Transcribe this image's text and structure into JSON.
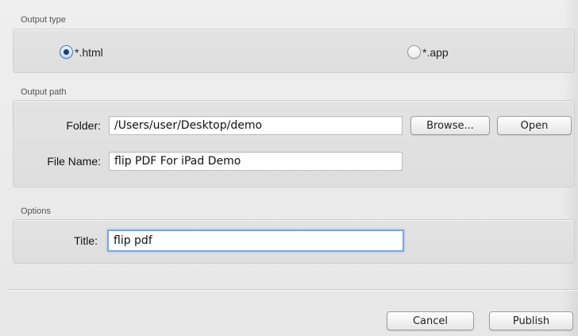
{
  "output_type": {
    "label": "Output type",
    "options": [
      {
        "label": "*.html",
        "selected": true
      },
      {
        "label": "*.app",
        "selected": false
      }
    ]
  },
  "output_path": {
    "label": "Output path",
    "folder_label": "Folder:",
    "folder_value": "/Users/user/Desktop/demo",
    "browse_label": "Browse...",
    "open_label": "Open",
    "file_name_label": "File Name:",
    "file_name_value": "flip PDF For iPad Demo"
  },
  "options": {
    "label": "Options",
    "title_label": "Title:",
    "title_value": "flip pdf"
  },
  "footer": {
    "cancel_label": "Cancel",
    "publish_label": "Publish"
  },
  "colors": {
    "accent": "#4b77b8",
    "focus_ring": "#7aa6e0",
    "background": "#ececec"
  }
}
